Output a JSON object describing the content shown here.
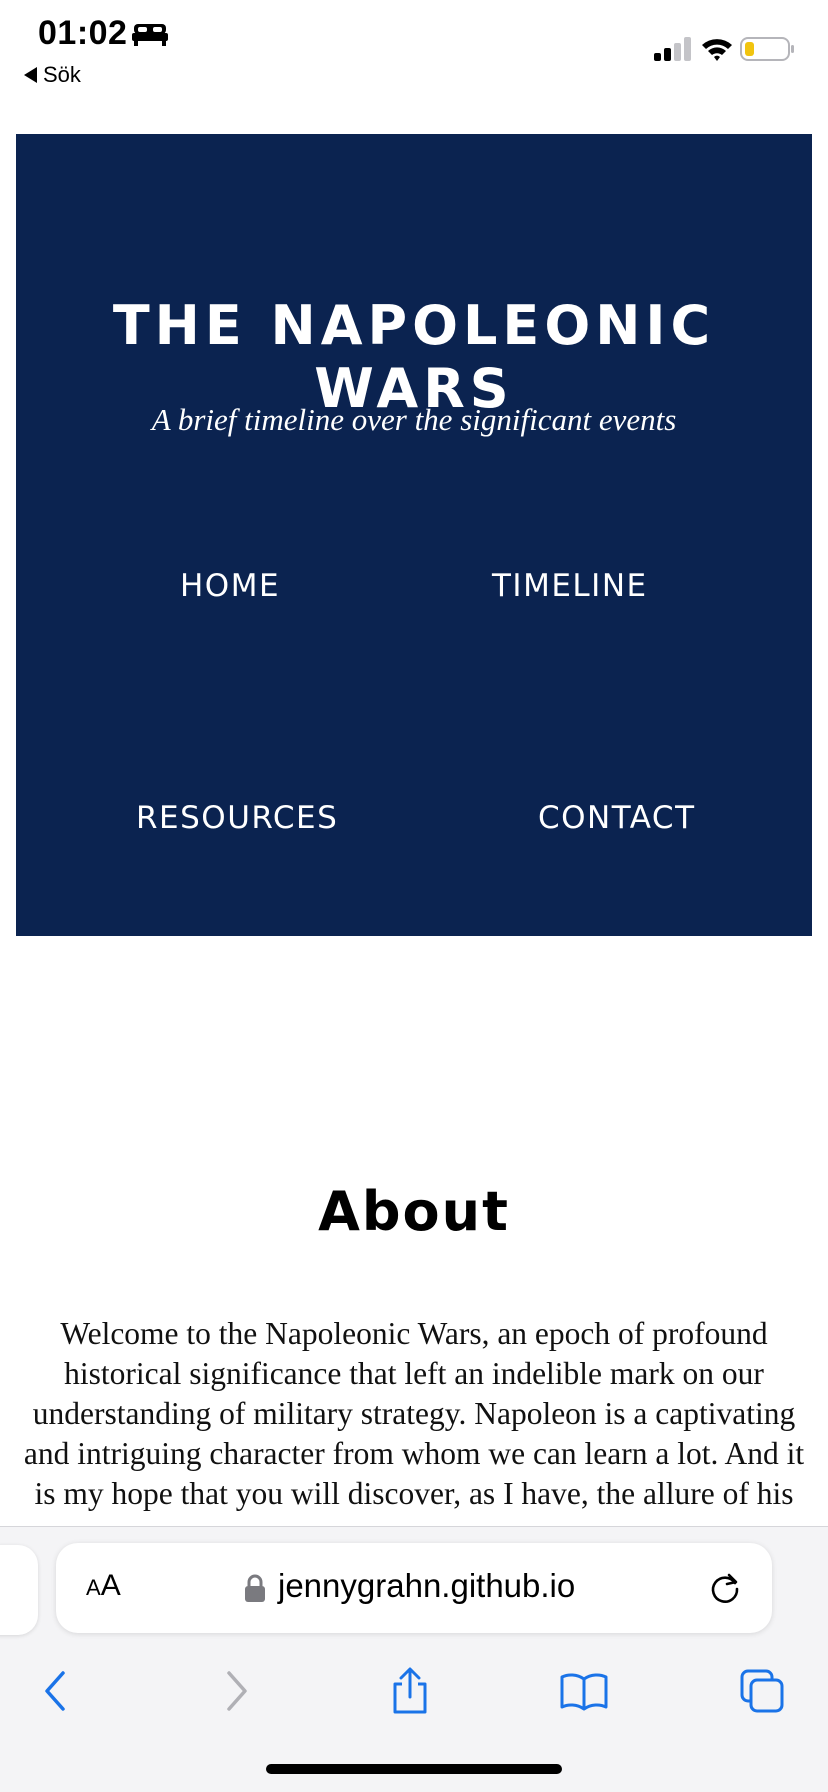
{
  "status_bar": {
    "time": "01:02",
    "back_app_label": "Sök",
    "icons": [
      "bed-icon",
      "cellular-signal-icon",
      "wifi-icon",
      "battery-icon"
    ]
  },
  "hero": {
    "title": "THE NAPOLEONIC WARS",
    "subtitle": "A brief timeline over the significant events",
    "background_color": "#0b2350",
    "nav": {
      "home": "HOME",
      "timeline": "TIMELINE",
      "resources": "RESOURCES",
      "contact": "CONTACT"
    }
  },
  "about": {
    "heading": "About",
    "text": "Welcome to the Napoleonic Wars, an epoch of profound historical significance that left an indelible mark on our understanding of military strategy. Napoleon is a captivating and intriguing character from whom we can learn a lot. And it is my hope that you will discover, as I have, the allure of his"
  },
  "browser": {
    "aa_label_small": "A",
    "aa_label_large": "A",
    "url": "jennygrahn.github.io",
    "toolbar_icons": [
      "back-icon",
      "forward-icon",
      "share-icon",
      "bookmarks-icon",
      "tabs-icon"
    ]
  }
}
